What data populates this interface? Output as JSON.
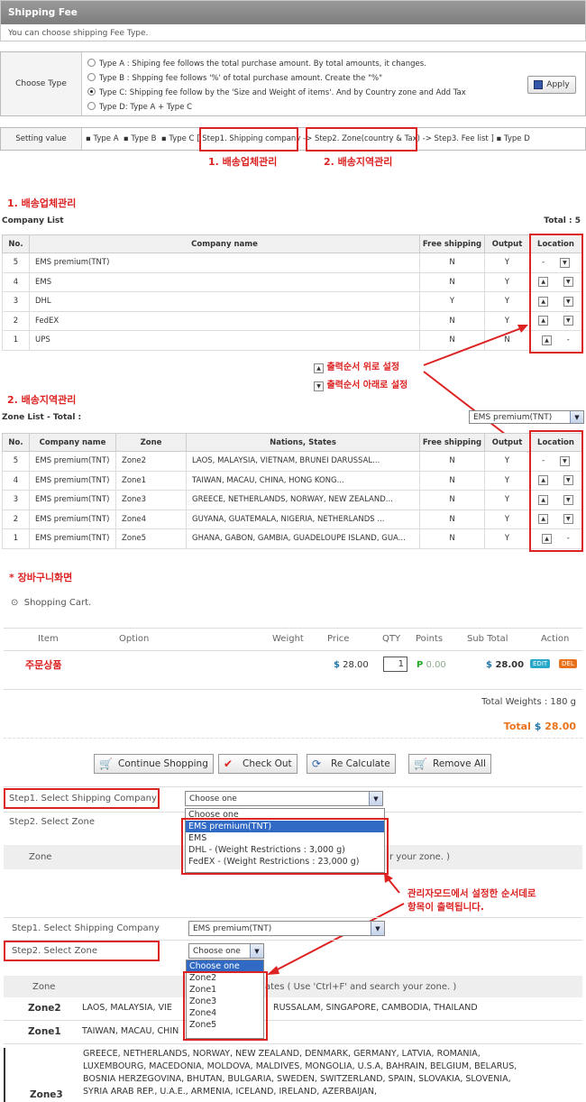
{
  "header": {
    "title": "Shipping Fee",
    "desc": "You can choose shipping Fee Type."
  },
  "choose_type": {
    "label": "Choose Type",
    "options": [
      "Type A : Shiping fee follows the total purchase amount. By total amounts, it changes.",
      "Type B : Shpping fee follows '%' of total purchase amount. Create the \"%\"",
      "Type C: Shipping fee follow by the 'Size and Weight of items'. And by Country zone and Add Tax",
      "Type D: Type A + Type C"
    ],
    "apply": "Apply"
  },
  "setting": {
    "label": "Setting value",
    "typeA": "Type A",
    "typeB": "Type B",
    "typeC": "Type C",
    "step1": "[ Step1. Shipping company",
    "step2": "Step2. Zone(country & Tax)",
    "step3": "Step3. Fee list ]",
    "typeD": "Type D"
  },
  "annot": {
    "a1": "1. 배송업체관리",
    "a2": "2. 배송지역관리",
    "sec1": "1. 배송업체관리",
    "sec2": "2. 배송지역관리",
    "up": "출력순서 위로 설정",
    "down": "출력순서 아래로 설정",
    "cart": "* 장바구니화면",
    "admin1": "관리자모드에서 설정한 순서데로",
    "admin2": "항목이 출력됩니다."
  },
  "company": {
    "title": "Company List",
    "total": "Total : 5",
    "headers": [
      "No.",
      "Company name",
      "Free shipping",
      "Output",
      "Location"
    ],
    "rows": [
      [
        "5",
        "EMS premium(TNT)",
        "N",
        "Y"
      ],
      [
        "4",
        "EMS",
        "N",
        "Y"
      ],
      [
        "3",
        "DHL",
        "Y",
        "Y"
      ],
      [
        "2",
        "FedEX",
        "N",
        "Y"
      ],
      [
        "1",
        "UPS",
        "N",
        "N"
      ]
    ]
  },
  "zone": {
    "title": "Zone List  - Total :",
    "select": "EMS premium(TNT)",
    "headers": [
      "No.",
      "Company name",
      "Zone",
      "Nations, States",
      "Free shipping",
      "Output",
      "Location"
    ],
    "rows": [
      [
        "5",
        "EMS premium(TNT)",
        "Zone2",
        "LAOS, MALAYSIA, VIETNAM, BRUNEI DARUSSAL...",
        "N",
        "Y"
      ],
      [
        "4",
        "EMS premium(TNT)",
        "Zone1",
        "TAIWAN, MACAU, CHINA, HONG KONG...",
        "N",
        "Y"
      ],
      [
        "3",
        "EMS premium(TNT)",
        "Zone3",
        "GREECE, NETHERLANDS, NORWAY, NEW ZEALAND...",
        "N",
        "Y"
      ],
      [
        "2",
        "EMS premium(TNT)",
        "Zone4",
        "GUYANA, GUATEMALA, NIGERIA, NETHERLANDS ...",
        "N",
        "Y"
      ],
      [
        "1",
        "EMS premium(TNT)",
        "Zone5",
        "GHANA, GABON, GAMBIA, GUADELOUPE ISLAND, GUA...",
        "N",
        "Y"
      ]
    ]
  },
  "cart": {
    "title": "Shopping Cart.",
    "headers": [
      "Item",
      "Option",
      "Weight",
      "Price",
      "QTY",
      "Points",
      "Sub Total",
      "Action"
    ],
    "item": "주문상품",
    "price": "28.00",
    "qty": "1",
    "points": "0.00",
    "subtotal": "28.00",
    "edit": "EDIT",
    "del": "DEL",
    "total_weights": "Total Weights : 180 g",
    "total_label": "Total",
    "total": "28.00"
  },
  "buttons": {
    "continue": "Continue Shopping",
    "checkout": "Check Out",
    "recalc": "Re Calculate",
    "remove": "Remove All"
  },
  "ship1": {
    "step1": "Step1. Select Shipping Company",
    "step2": "Step2. Select Zone",
    "select": "Choose one",
    "zone": "Zone",
    "hint": "r your zone. )",
    "options": [
      "Choose one",
      "EMS premium(TNT)",
      "EMS",
      "DHL - (Weight Restrictions : 3,000 g)",
      "FedEX - (Weight Restrictions : 23,000 g)"
    ]
  },
  "ship2": {
    "step1": "Step1. Select Shipping Company",
    "step2": "Step2. Select Zone",
    "company": "EMS premium(TNT)",
    "select": "Choose one",
    "zone_hdr": "Zone",
    "hint": "ates ( Use 'Ctrl+F' and search your zone. )",
    "options": [
      "Choose one",
      "Zone2",
      "Zone1",
      "Zone3",
      "Zone4",
      "Zone5"
    ],
    "z2": "Zone2",
    "z2t": "LAOS, MALAYSIA, VIE",
    "z2t2": "RUSSALAM, SINGAPORE, CAMBODIA, THAILAND",
    "z1": "Zone1",
    "z1t": "TAIWAN, MACAU, CHIN",
    "z3": "Zone3",
    "z3t": "GREECE, NETHERLANDS, NORWAY, NEW ZEALAND, DENMARK, GERMANY, LATVIA, ROMANIA, LUXEMBOURG, MACEDONIA, MOLDOVA, MALDIVES, MONGOLIA, U.S.A, BAHRAIN, BELGIUM, BELARUS, BOSNIA HERZEGOVINA, BHUTAN, BULGARIA, SWEDEN, SWITZERLAND, SPAIN, SLOVAKIA, SLOVENIA, SYRIA ARAB REP., U.A.E., ARMENIA, ICELAND, IRELAND, AZERBAIJAN,"
  },
  "colors": {
    "red": "#dd2222",
    "orange": "#e8731c",
    "teal": "#2aa8c8"
  }
}
